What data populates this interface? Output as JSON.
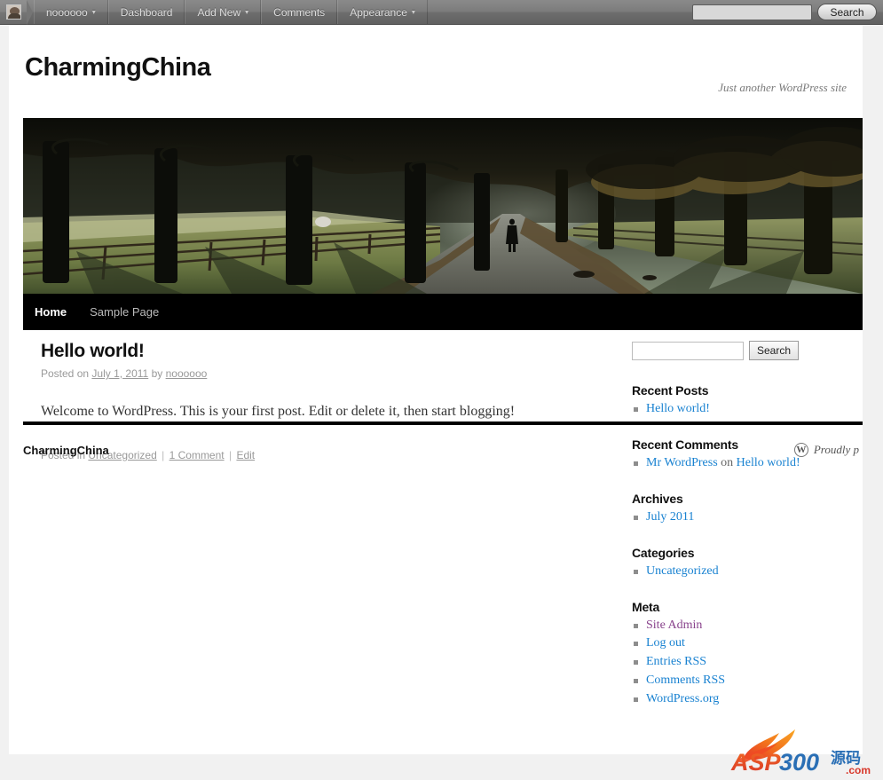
{
  "adminbar": {
    "avatar_name": "avatar",
    "items": [
      {
        "label": "noooooo",
        "has_caret": true
      },
      {
        "label": "Dashboard",
        "has_caret": false
      },
      {
        "label": "Add New",
        "has_caret": true
      },
      {
        "label": "Comments",
        "has_caret": false
      },
      {
        "label": "Appearance",
        "has_caret": true
      }
    ],
    "search": {
      "value": "",
      "placeholder": "",
      "button_label": "Search"
    }
  },
  "branding": {
    "site_title": "CharmingChina",
    "site_description": "Just another WordPress site"
  },
  "nav": {
    "items": [
      {
        "label": "Home",
        "current": true
      },
      {
        "label": "Sample Page",
        "current": false
      }
    ]
  },
  "post": {
    "title": "Hello world!",
    "meta_posted_on": "Posted on",
    "meta_date": "July 1, 2011",
    "meta_by": "by",
    "meta_author": "noooooo",
    "body": "Welcome to WordPress. This is your first post. Edit or delete it, then start blogging!",
    "footer_posted_in": "Posted in",
    "footer_category": "Uncategorized",
    "footer_comments": "1 Comment",
    "footer_edit": "Edit",
    "separator": "|"
  },
  "sidebar": {
    "search": {
      "value": "",
      "placeholder": "",
      "button_label": "Search"
    },
    "widgets": [
      {
        "title": "Recent Posts",
        "items": [
          {
            "text": "Hello world!",
            "style": "link"
          }
        ]
      },
      {
        "title": "Recent Comments",
        "items": [
          {
            "text": "Mr WordPress",
            "style": "link",
            "mid": "on",
            "tail": "Hello world!"
          }
        ]
      },
      {
        "title": "Archives",
        "items": [
          {
            "text": "July 2011",
            "style": "link"
          }
        ]
      },
      {
        "title": "Categories",
        "items": [
          {
            "text": "Uncategorized",
            "style": "link"
          }
        ]
      },
      {
        "title": "Meta",
        "items": [
          {
            "text": "Site Admin",
            "style": "visited"
          },
          {
            "text": "Log out",
            "style": "link"
          },
          {
            "text": "Entries RSS",
            "style": "link",
            "abbr": "RSS"
          },
          {
            "text": "Comments RSS",
            "style": "link",
            "abbr": "RSS"
          },
          {
            "text": "WordPress.org",
            "style": "link"
          }
        ]
      }
    ]
  },
  "footer": {
    "site_name": "CharmingChina",
    "generator_text": "Proudly p",
    "wp_mark": "W"
  },
  "watermark": {
    "text_asp": "ASP",
    "text_300": "300",
    "text_cn": "源码",
    "text_com": ".com"
  },
  "colors": {
    "link": "#1982d1",
    "visited": "#89438c",
    "accent_black": "#000000",
    "page_bg": "#f1f1f1",
    "admin_bar": "#737373"
  }
}
